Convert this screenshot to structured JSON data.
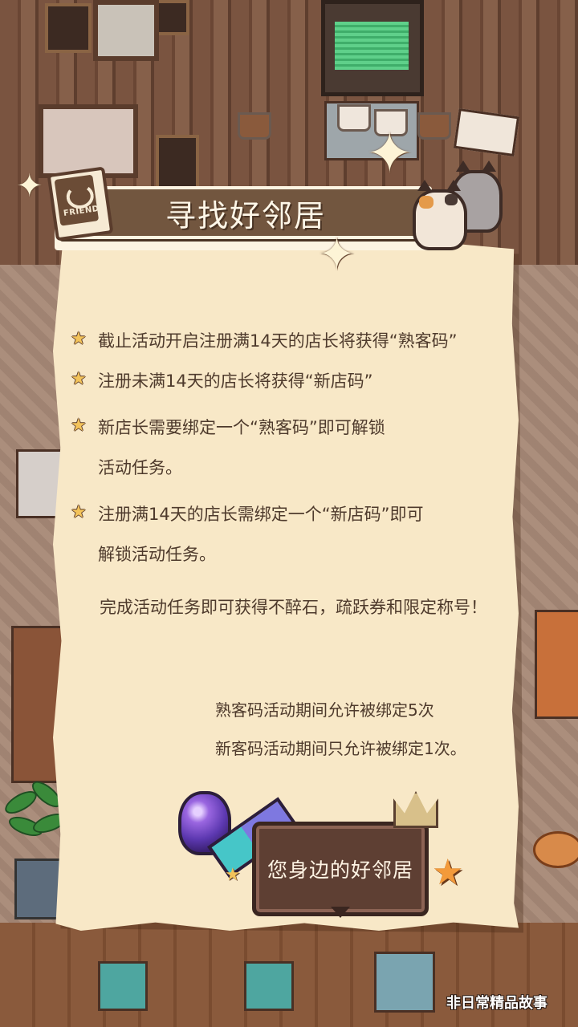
{
  "title": "寻找好邻居",
  "badge_text": "FRIEND",
  "rules": [
    {
      "icon": "star-icon",
      "text": "截止活动开启注册满14天的店长将获得“熟客码”"
    },
    {
      "icon": "star-icon",
      "text": "注册未满14天的店长将获得“新店码”"
    },
    {
      "icon": "star-icon",
      "text": "新店长需要绑定一个“熟客码”即可解锁\n活动任务。"
    },
    {
      "icon": "star-icon",
      "text": "注册满14天的店长需绑定一个“新店码”即可\n解锁活动任务。"
    }
  ],
  "reward_text": "完成活动任务即可获得不醉石，疏跃券和限定称号！",
  "limits": [
    "熟客码活动期间允许被绑定5次",
    "新客码活动期间只允许被绑定1次。"
  ],
  "bubble_text": "您身边的好邻居",
  "watermark": "非日常精品故事",
  "colors": {
    "paper": "#f8e8c7",
    "banner": "#72563f",
    "text": "#4e3a2c",
    "bullet_star": "#f3c35a",
    "bubble": "#5e3f33"
  }
}
